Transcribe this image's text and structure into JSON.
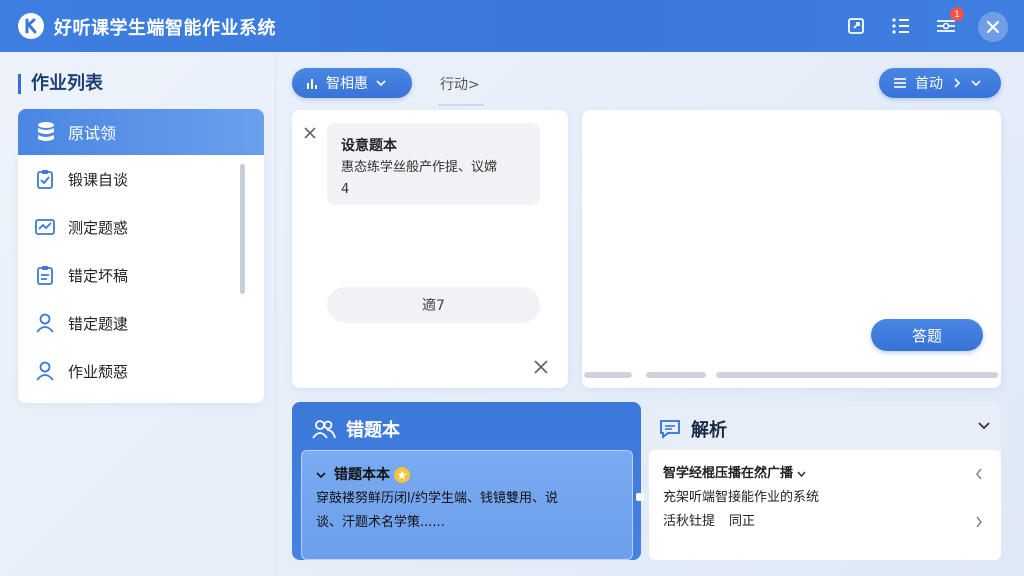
{
  "app": {
    "title": "好听课学生端智能作业系统",
    "notification_count": "1"
  },
  "sidebar": {
    "heading": "作业列表",
    "active_item": "原试领",
    "items": [
      {
        "label": "锻课自谈",
        "icon": "clipboard-icon"
      },
      {
        "label": "测定题惑",
        "icon": "chart-icon"
      },
      {
        "label": "错定坏稿",
        "icon": "clipboard-icon"
      },
      {
        "label": "错定题逮",
        "icon": "user-icon"
      },
      {
        "label": "作业颓惡",
        "icon": "user-icon"
      }
    ]
  },
  "toolbar": {
    "left_pill": "智相惠",
    "tab": "行动>",
    "right_pill": "首动"
  },
  "question": {
    "title": "设意题本",
    "line1": "惠态练学丝般产作提、议嫦",
    "line2": "4",
    "pill": "適7"
  },
  "answer_button": "答题",
  "wrong_book": {
    "title": "错题本",
    "item_title": "错题本本",
    "line1": "穿鼓褛努鲜历闭l/约学生端、钱镜雙用、说",
    "line2": "谈、汗题术名学策......"
  },
  "analysis": {
    "title": "解析",
    "line1": "智学经棍压播在然广播",
    "line2": "充架听端智接能作业的系统",
    "line3a": "活秋钍提",
    "line3b": "同正"
  },
  "colors": {
    "primary": "#3b78da",
    "badge": "#f0544f",
    "star": "#f3c43e"
  }
}
